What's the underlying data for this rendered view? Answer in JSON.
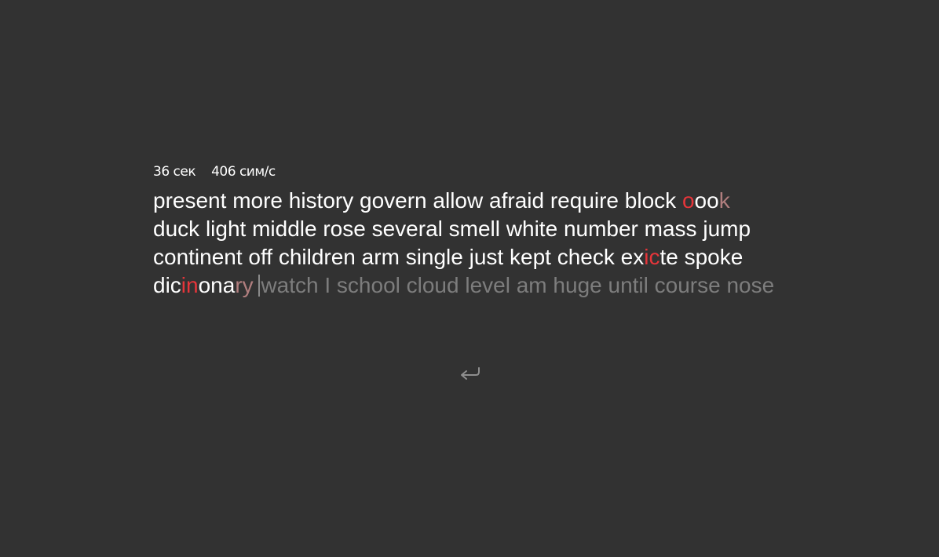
{
  "stats": {
    "time": "36 сек",
    "speed": "406 сим/с"
  },
  "colors": {
    "background": "#323232",
    "correct": "#ffffff",
    "error": "#e6353a",
    "extra": "#b07e7e",
    "pending": "#7d7d7d",
    "caret": "#8a8a8a"
  },
  "words": [
    {
      "parts": [
        {
          "t": "present",
          "s": "correct"
        }
      ]
    },
    {
      "parts": [
        {
          "t": "more",
          "s": "correct"
        }
      ]
    },
    {
      "parts": [
        {
          "t": "history",
          "s": "correct"
        }
      ]
    },
    {
      "parts": [
        {
          "t": "govern",
          "s": "correct"
        }
      ]
    },
    {
      "parts": [
        {
          "t": "allow",
          "s": "correct"
        }
      ]
    },
    {
      "parts": [
        {
          "t": "afraid",
          "s": "correct"
        }
      ]
    },
    {
      "parts": [
        {
          "t": "require",
          "s": "correct"
        }
      ]
    },
    {
      "parts": [
        {
          "t": "block",
          "s": "correct"
        }
      ]
    },
    {
      "parts": [
        {
          "t": "o",
          "s": "error"
        },
        {
          "t": "oo",
          "s": "correct"
        },
        {
          "t": "k",
          "s": "extra"
        }
      ]
    },
    {
      "parts": [
        {
          "t": "duck",
          "s": "correct"
        }
      ]
    },
    {
      "parts": [
        {
          "t": "light",
          "s": "correct"
        }
      ]
    },
    {
      "parts": [
        {
          "t": "middle",
          "s": "correct"
        }
      ]
    },
    {
      "parts": [
        {
          "t": "rose",
          "s": "correct"
        }
      ]
    },
    {
      "parts": [
        {
          "t": "several",
          "s": "correct"
        }
      ]
    },
    {
      "parts": [
        {
          "t": "smell",
          "s": "correct"
        }
      ]
    },
    {
      "parts": [
        {
          "t": "white",
          "s": "correct"
        }
      ]
    },
    {
      "parts": [
        {
          "t": "number",
          "s": "correct"
        }
      ]
    },
    {
      "parts": [
        {
          "t": "mass",
          "s": "correct"
        }
      ]
    },
    {
      "parts": [
        {
          "t": "jump",
          "s": "correct"
        }
      ]
    },
    {
      "parts": [
        {
          "t": "continent",
          "s": "correct"
        }
      ]
    },
    {
      "parts": [
        {
          "t": "off",
          "s": "correct"
        }
      ]
    },
    {
      "parts": [
        {
          "t": "children",
          "s": "correct"
        }
      ]
    },
    {
      "parts": [
        {
          "t": "arm",
          "s": "correct"
        }
      ]
    },
    {
      "parts": [
        {
          "t": "single",
          "s": "correct"
        }
      ]
    },
    {
      "parts": [
        {
          "t": "just",
          "s": "correct"
        }
      ]
    },
    {
      "parts": [
        {
          "t": "kept",
          "s": "correct"
        }
      ]
    },
    {
      "parts": [
        {
          "t": "check",
          "s": "correct"
        }
      ]
    },
    {
      "parts": [
        {
          "t": "ex",
          "s": "correct"
        },
        {
          "t": "ic",
          "s": "error"
        },
        {
          "t": "te",
          "s": "correct"
        }
      ]
    },
    {
      "parts": [
        {
          "t": "spoke",
          "s": "correct"
        }
      ]
    },
    {
      "parts": [
        {
          "t": "dic",
          "s": "correct"
        },
        {
          "t": "in",
          "s": "error"
        },
        {
          "t": "ona",
          "s": "correct"
        },
        {
          "t": "ry",
          "s": "extra"
        }
      ],
      "caret_after": true
    },
    {
      "parts": [
        {
          "t": "watch",
          "s": "pending"
        }
      ]
    },
    {
      "parts": [
        {
          "t": "I",
          "s": "pending"
        }
      ]
    },
    {
      "parts": [
        {
          "t": "school",
          "s": "pending"
        }
      ]
    },
    {
      "parts": [
        {
          "t": "cloud",
          "s": "pending"
        }
      ]
    },
    {
      "parts": [
        {
          "t": "level",
          "s": "pending"
        }
      ]
    },
    {
      "parts": [
        {
          "t": "am",
          "s": "pending"
        }
      ]
    },
    {
      "parts": [
        {
          "t": "huge",
          "s": "pending"
        }
      ]
    },
    {
      "parts": [
        {
          "t": "until",
          "s": "pending"
        }
      ]
    },
    {
      "parts": [
        {
          "t": "course",
          "s": "pending"
        }
      ]
    },
    {
      "parts": [
        {
          "t": "nose",
          "s": "pending"
        }
      ]
    }
  ],
  "restart": {
    "icon": "restart-icon"
  }
}
